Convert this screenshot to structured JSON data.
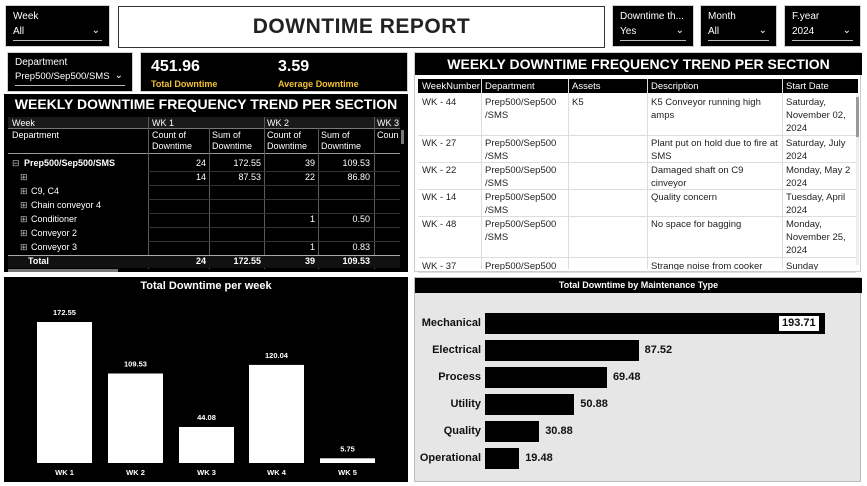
{
  "slicers": {
    "week": {
      "label": "Week",
      "value": "All"
    },
    "downtime": {
      "label": "Downtime th...",
      "value": "Yes"
    },
    "month": {
      "label": "Month",
      "value": "All"
    },
    "fyear": {
      "label": "F.year",
      "value": "2024"
    },
    "department": {
      "label": "Department",
      "value": "Prep500/Sep500/SMS"
    }
  },
  "report_title": "DOWNTIME REPORT",
  "kpis": {
    "total": {
      "value": "451.96",
      "label": "Total Downtime"
    },
    "average": {
      "value": "3.59",
      "label": "Average Downtime"
    }
  },
  "matrix": {
    "title": "WEEKLY DOWNTIME FREQUENCY TREND PER SECTION",
    "row_header_1": "Week",
    "row_header_2": "Department",
    "weeks": [
      "WK 1",
      "WK 2",
      "WK 3"
    ],
    "col_count": "Count of Downtime",
    "col_sum": "Sum of Downtime",
    "col_count_partial": "Coun",
    "rows": [
      {
        "label": "Prep500/Sep500/SMS",
        "expander": "⊟",
        "c1": "24",
        "s1": "172.55",
        "c2": "39",
        "s2": "109.53"
      },
      {
        "label": "",
        "expander": "⊞",
        "c1": "14",
        "s1": "87.53",
        "c2": "22",
        "s2": "86.80"
      },
      {
        "label": "C9, C4",
        "expander": "⊞",
        "c1": "",
        "s1": "",
        "c2": "",
        "s2": ""
      },
      {
        "label": "Chain conveyor 4",
        "expander": "⊞",
        "c1": "",
        "s1": "",
        "c2": "",
        "s2": ""
      },
      {
        "label": "Conditioner",
        "expander": "⊞",
        "c1": "",
        "s1": "",
        "c2": "1",
        "s2": "0.50"
      },
      {
        "label": "Conveyor 2",
        "expander": "⊞",
        "c1": "",
        "s1": "",
        "c2": "",
        "s2": ""
      },
      {
        "label": "Conveyor 3",
        "expander": "⊞",
        "c1": "",
        "s1": "",
        "c2": "1",
        "s2": "0.83"
      }
    ],
    "total": {
      "label": "Total",
      "c1": "24",
      "s1": "172.55",
      "c2": "39",
      "s2": "109.53"
    }
  },
  "table": {
    "title": "WEEKLY DOWNTIME FREQUENCY TREND PER SECTION",
    "headers": [
      "WeekNumber",
      "Department",
      "Assets",
      "Description",
      "Start Date"
    ],
    "rows": [
      {
        "week": "WK - 44",
        "dept": "Prep500/Sep500 /SMS",
        "asset": "K5",
        "desc": "K5 Conveyor running high amps",
        "date": "Saturday, November 02, 2024"
      },
      {
        "week": "WK - 27",
        "dept": "Prep500/Sep500 /SMS",
        "asset": "",
        "desc": "Plant put on hold due to fire at SMS",
        "date": "Saturday, July 2024"
      },
      {
        "week": "WK - 22",
        "dept": "Prep500/Sep500 /SMS",
        "asset": "",
        "desc": "Damaged shaft on C9 cinveyor",
        "date": "Monday, May 2 2024"
      },
      {
        "week": "WK - 14",
        "dept": "Prep500/Sep500 /SMS",
        "asset": "",
        "desc": "Quality concern",
        "date": "Tuesday, April 2024"
      },
      {
        "week": "WK - 48",
        "dept": "Prep500/Sep500 /SMS",
        "asset": "",
        "desc": "No space for bagging",
        "date": "Monday, November 25, 2024"
      },
      {
        "week": "WK - 37",
        "dept": "Prep500/Sep500",
        "asset": "",
        "desc": "Strange noise from cooker",
        "date": "Sunday"
      }
    ]
  },
  "weekly_chart": {
    "title": "Total Downtime per week",
    "chart_data": {
      "type": "bar",
      "title": "Total Downtime per week",
      "categories": [
        "WK 1",
        "WK 2",
        "WK 3",
        "WK 4",
        "WK 5"
      ],
      "values": [
        172.55,
        109.53,
        44.08,
        120.04,
        5.75
      ],
      "labels": [
        "172.55",
        "109.53",
        "44.08",
        "120.04",
        "5.75"
      ],
      "ylim": [
        0,
        172.55
      ],
      "bar_color": "#ffffff",
      "background": "#000000"
    }
  },
  "maint_chart": {
    "title": "Total Downtime by Maintenance Type",
    "chart_data": {
      "type": "bar",
      "orientation": "horizontal",
      "title": "Total Downtime by Maintenance Type",
      "categories": [
        "Mechanical",
        "Electrical",
        "Process",
        "Utility",
        "Quality",
        "Operational"
      ],
      "values": [
        193.71,
        87.52,
        69.48,
        50.88,
        30.88,
        19.48
      ],
      "labels": [
        "193.71",
        "87.52",
        "69.48",
        "50.88",
        "30.88",
        "19.48"
      ],
      "bar_color": "#000000",
      "background": "#e6e6e6"
    }
  }
}
